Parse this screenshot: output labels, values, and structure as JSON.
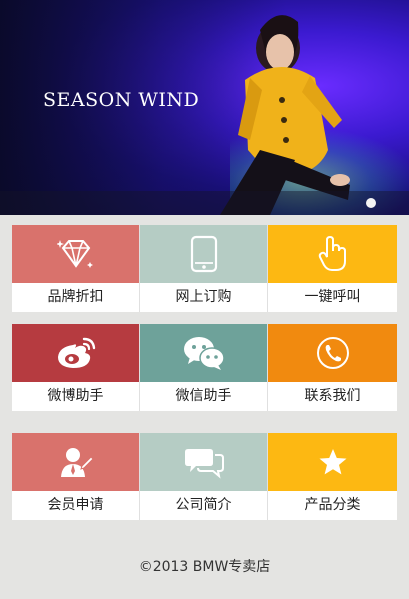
{
  "banner": {
    "title": "SEASON WIND"
  },
  "colors": {
    "pink": "#d9726c",
    "mint": "#b5ccc4",
    "yellow": "#fdb812",
    "red": "#b63b40",
    "teal": "#6ea29a",
    "orange": "#f18a0f"
  },
  "grid1": {
    "tiles": [
      {
        "label": "品牌折扣",
        "icon": "diamond-icon"
      },
      {
        "label": "网上订购",
        "icon": "phone-icon"
      },
      {
        "label": "一键呼叫",
        "icon": "hand-pointer-icon"
      }
    ]
  },
  "grid2": {
    "tiles": [
      {
        "label": "微博助手",
        "icon": "weibo-icon"
      },
      {
        "label": "微信助手",
        "icon": "wechat-icon"
      },
      {
        "label": "联系我们",
        "icon": "call-icon"
      }
    ]
  },
  "grid3": {
    "tiles": [
      {
        "label": "会员申请",
        "icon": "member-icon"
      },
      {
        "label": "公司简介",
        "icon": "chat-bubbles-icon"
      },
      {
        "label": "产品分类",
        "icon": "star-icon"
      }
    ]
  },
  "footer": {
    "text": "©2013  BMW专卖店"
  }
}
